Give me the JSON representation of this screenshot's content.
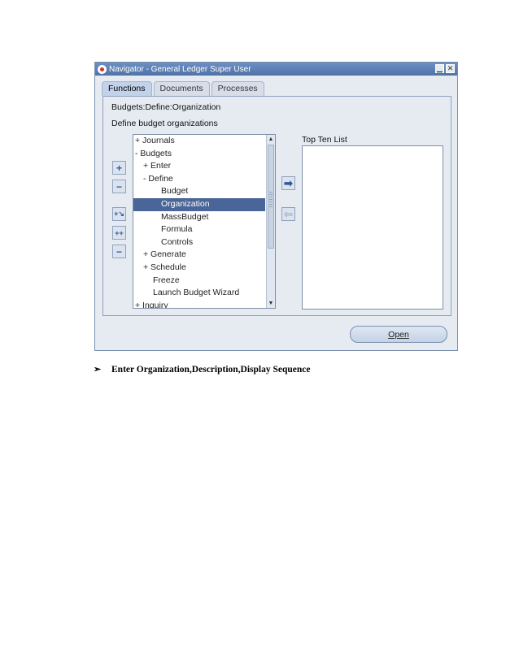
{
  "window": {
    "title": "Navigator - General Ledger Super User",
    "minimize_label": "▁",
    "close_label": "✕"
  },
  "tabs": [
    {
      "label": "Functions",
      "active": true
    },
    {
      "label": "Documents",
      "active": false
    },
    {
      "label": "Processes",
      "active": false
    }
  ],
  "breadcrumb": "Budgets:Define:Organization",
  "description": "Define budget organizations",
  "tree": [
    {
      "label": "+ Journals",
      "indent": 0,
      "selected": false
    },
    {
      "label": "- Budgets",
      "indent": 0,
      "selected": false
    },
    {
      "label": "+ Enter",
      "indent": 1,
      "selected": false
    },
    {
      "label": "- Define",
      "indent": 1,
      "selected": false
    },
    {
      "label": "Budget",
      "indent": 2,
      "selected": false
    },
    {
      "label": "Organization",
      "indent": 2,
      "selected": true
    },
    {
      "label": "MassBudget",
      "indent": 2,
      "selected": false
    },
    {
      "label": "Formula",
      "indent": 2,
      "selected": false
    },
    {
      "label": "Controls",
      "indent": 2,
      "selected": false
    },
    {
      "label": "+ Generate",
      "indent": 1,
      "selected": false
    },
    {
      "label": "+ Schedule",
      "indent": 1,
      "selected": false
    },
    {
      "label": "Freeze",
      "indent": 1,
      "selected": false
    },
    {
      "label": "Launch Budget Wizard",
      "indent": 1,
      "selected": false
    },
    {
      "label": "+ Inquiry",
      "indent": 0,
      "selected": false
    }
  ],
  "side_buttons": {
    "expand": "+",
    "collapse": "−",
    "expand_all": "+↘",
    "expand_branch": "++",
    "collapse_all": "−"
  },
  "transfer": {
    "add_arrow": "➡",
    "remove_arrow": "⇦"
  },
  "top_ten": {
    "label": "Top Ten List",
    "items": []
  },
  "open_button": {
    "label": "Open"
  },
  "instruction": "Enter Organization,Description,Display  Sequence",
  "instruction_bullet": "➢",
  "colors": {
    "selection": "#4a6597",
    "titlebar": "#4f72a8",
    "panel_bg": "#e6ebf2"
  }
}
